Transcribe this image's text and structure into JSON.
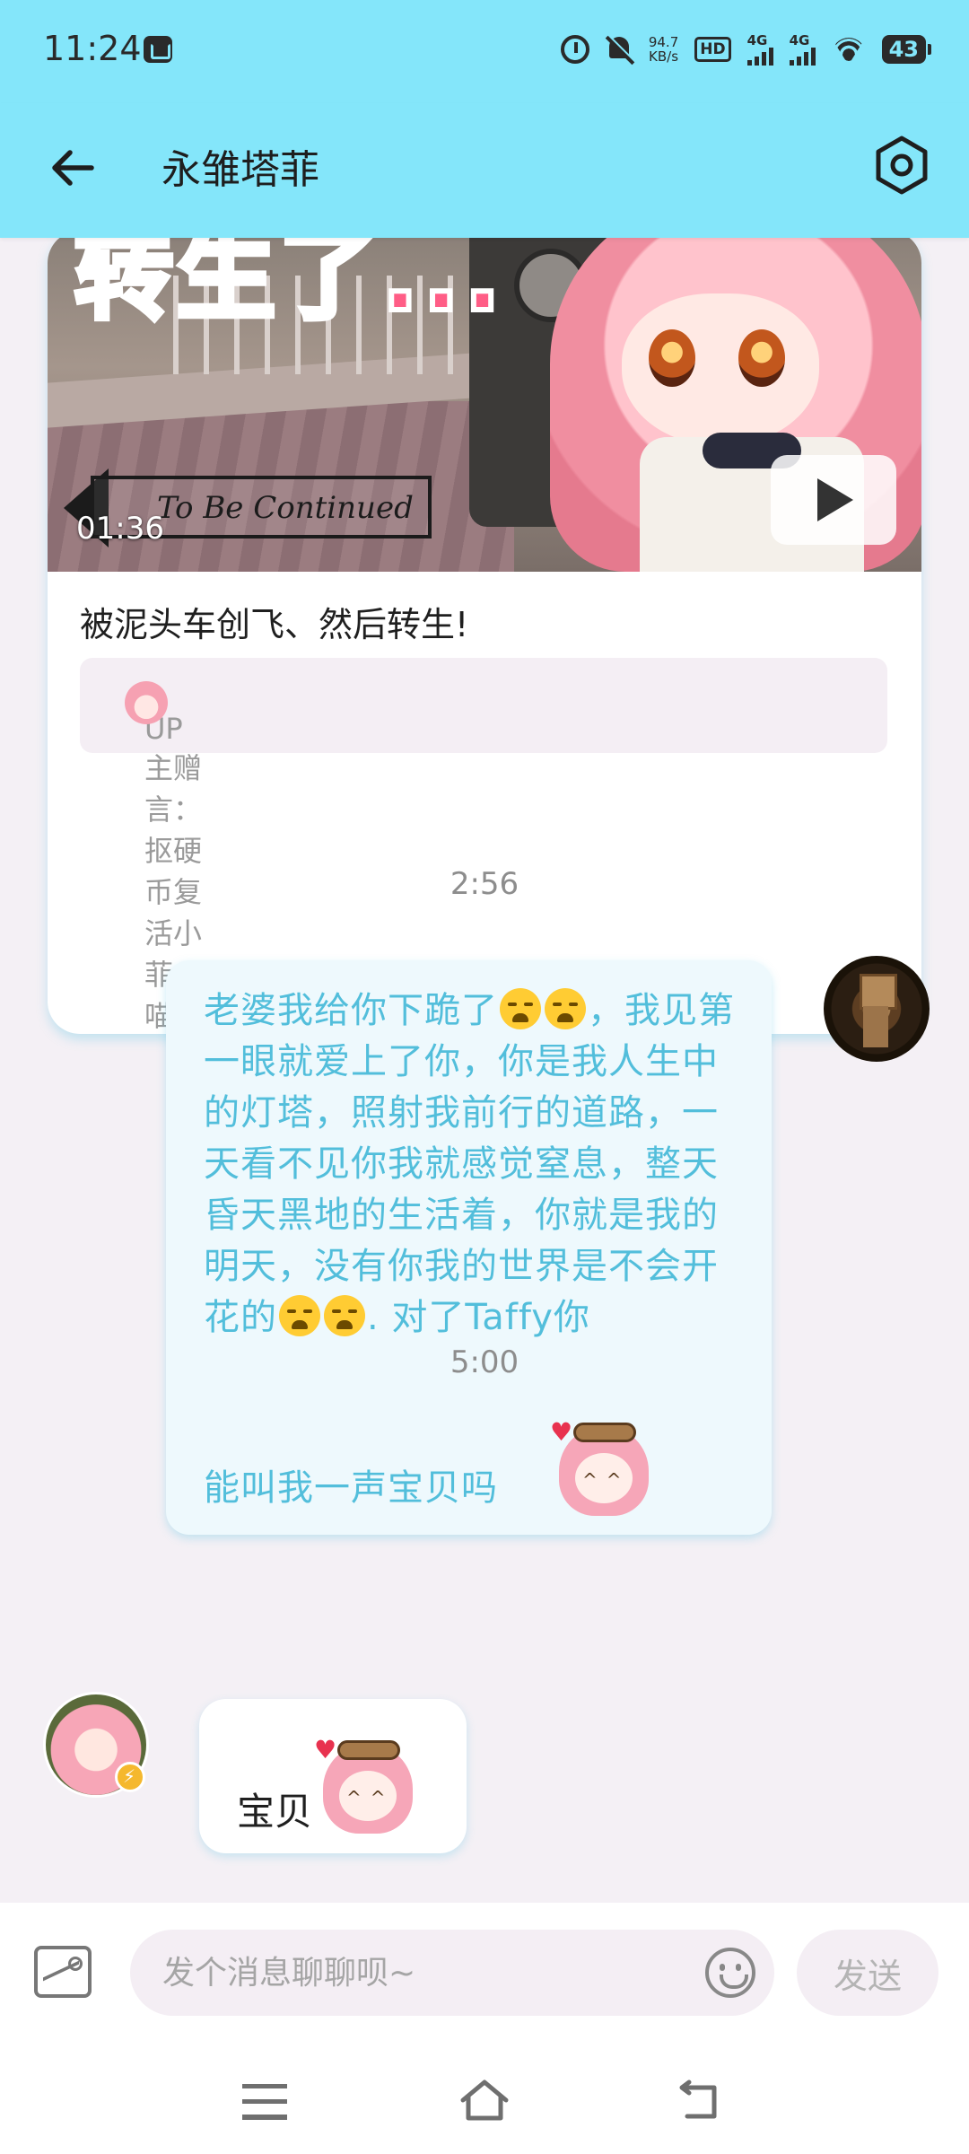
{
  "status_bar": {
    "time": "11:24",
    "net_speed_value": "94.7",
    "net_speed_unit": "KB/s",
    "hd_label": "HD",
    "sim1_label": "4G",
    "sim2_label": "4G",
    "battery": "43"
  },
  "header": {
    "title": "永雏塔菲"
  },
  "video_card": {
    "overlay_text": "转生了...",
    "banner_text": "To Be Continued",
    "duration": "01:36",
    "title": "被泥头车创飞、然后转生!",
    "up_note": "UP主赠言：抠硬币复活小菲喵!"
  },
  "messages": {
    "timestamp_1": "2:56",
    "me_text_1": "老婆我给你下跪了",
    "me_text_2": "，我见第一眼就爱上了你，你是我人生中的灯塔，照射我前行的道路，一天看不见你我就感觉窒息，整天昏天黑地的生活着，你就是我的明天，没有你我的世界是不会开花的",
    "me_text_3": ". 对了Taffy你",
    "me_text_4": "能叫我一声宝贝吗",
    "timestamp_2": "5:00",
    "taffy_text": "宝贝"
  },
  "input_bar": {
    "placeholder": "发个消息聊聊呗~",
    "send_label": "发送"
  },
  "colors": {
    "header_bg": "#84e6fa",
    "my_bubble_text": "#52bedb",
    "page_bg": "#f4f0f5"
  },
  "icons": {
    "back": "arrow-left-icon",
    "settings": "hexagon-settings-icon",
    "play": "play-icon",
    "image": "image-icon",
    "emoji": "smiley-icon"
  }
}
